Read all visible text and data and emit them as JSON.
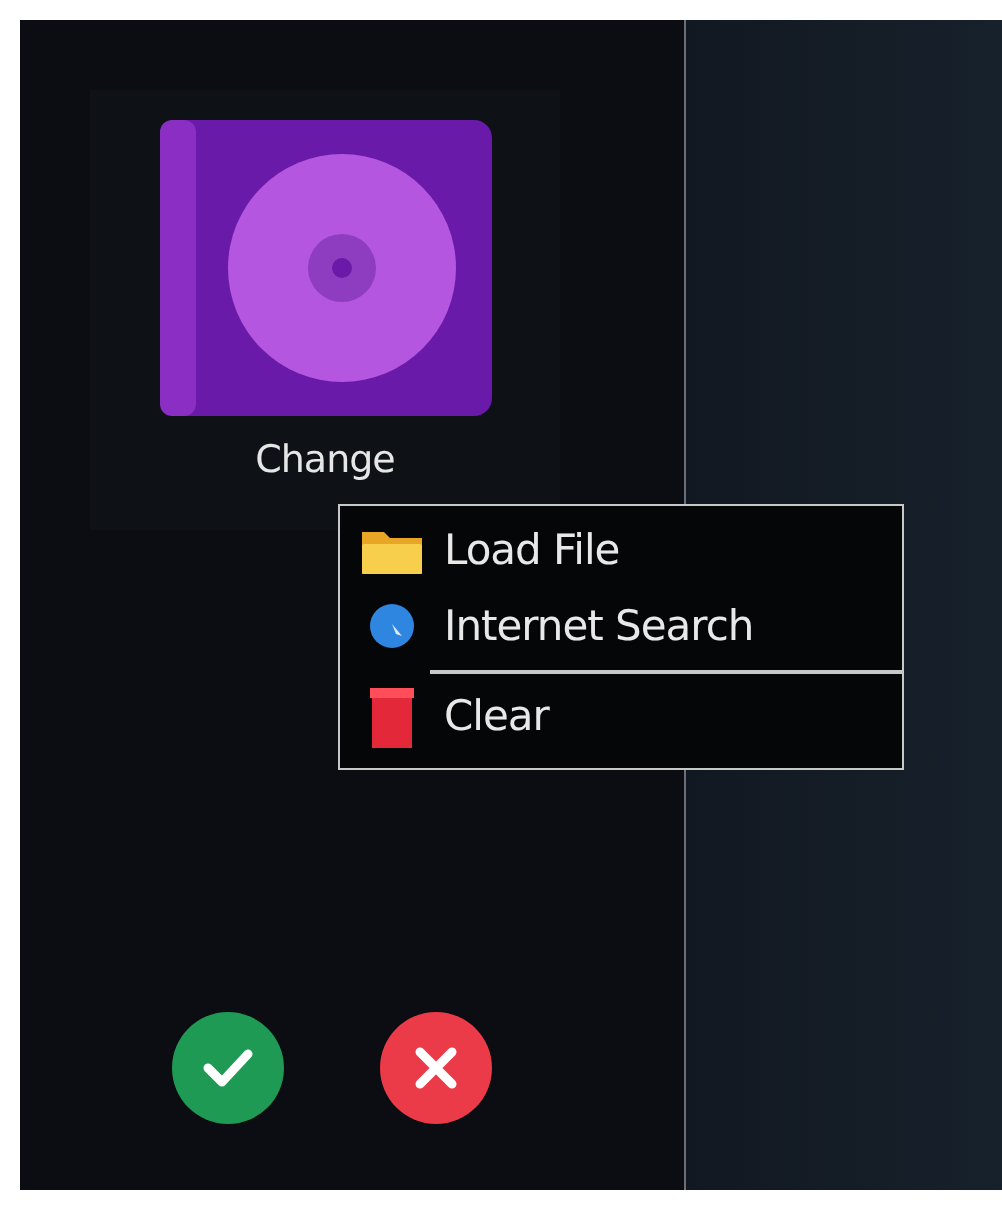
{
  "cover": {
    "label": "Change"
  },
  "context_menu": {
    "items": [
      {
        "kind": "folder",
        "label": "Load File",
        "separator_before": false
      },
      {
        "kind": "globe",
        "label": "Internet Search",
        "separator_before": false
      },
      {
        "kind": "trash",
        "label": "Clear",
        "separator_before": true
      }
    ]
  },
  "buttons": [
    {
      "kind": "confirm"
    },
    {
      "kind": "cancel"
    }
  ]
}
